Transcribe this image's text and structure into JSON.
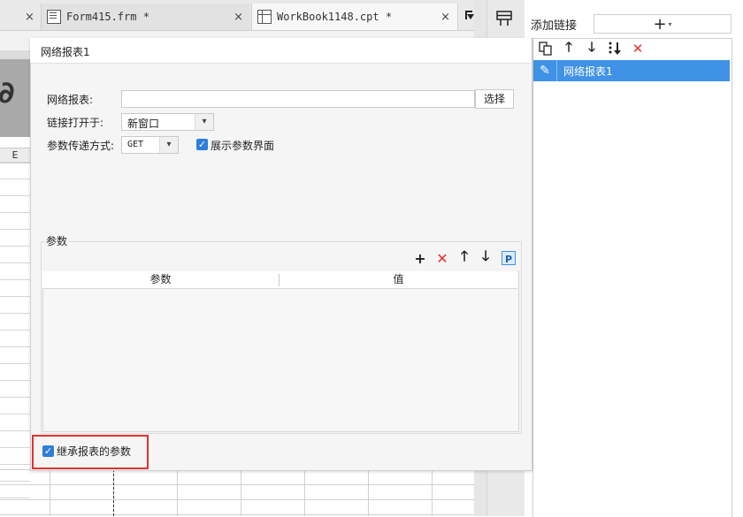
{
  "tabs": [
    {
      "label": "Form415.frm *",
      "close": "×"
    },
    {
      "label": "WorkBook1148.cpt *",
      "close": "×"
    }
  ],
  "sheet": {
    "column_header": "E"
  },
  "right_panel": {
    "add_link_label": "添加链接",
    "add_button_symbol": "+",
    "toolbar_icons": [
      "copy-icon",
      "arrow-up-icon",
      "arrow-down-icon",
      "sort-icon",
      "delete-icon"
    ],
    "items": [
      {
        "label": "网络报表1",
        "selected": true
      }
    ]
  },
  "dialog": {
    "title": "网络报表1",
    "report_label": "网络报表:",
    "report_value": "",
    "choose_button": "选择",
    "open_in_label": "链接打开于:",
    "open_in_value": "新窗口",
    "param_method_label": "参数传递方式:",
    "param_method_value": "GET",
    "show_param_ui_label": "展示参数界面",
    "show_param_ui_checked": true,
    "params_section_label": "参数",
    "param_columns": [
      "参数",
      "值"
    ],
    "param_rows": [],
    "inherit_params_label": "继承报表的参数",
    "inherit_params_checked": true
  },
  "colors": {
    "accent": "#3f92e6",
    "delete": "#e53030",
    "checkbox": "#2f7fd8"
  }
}
